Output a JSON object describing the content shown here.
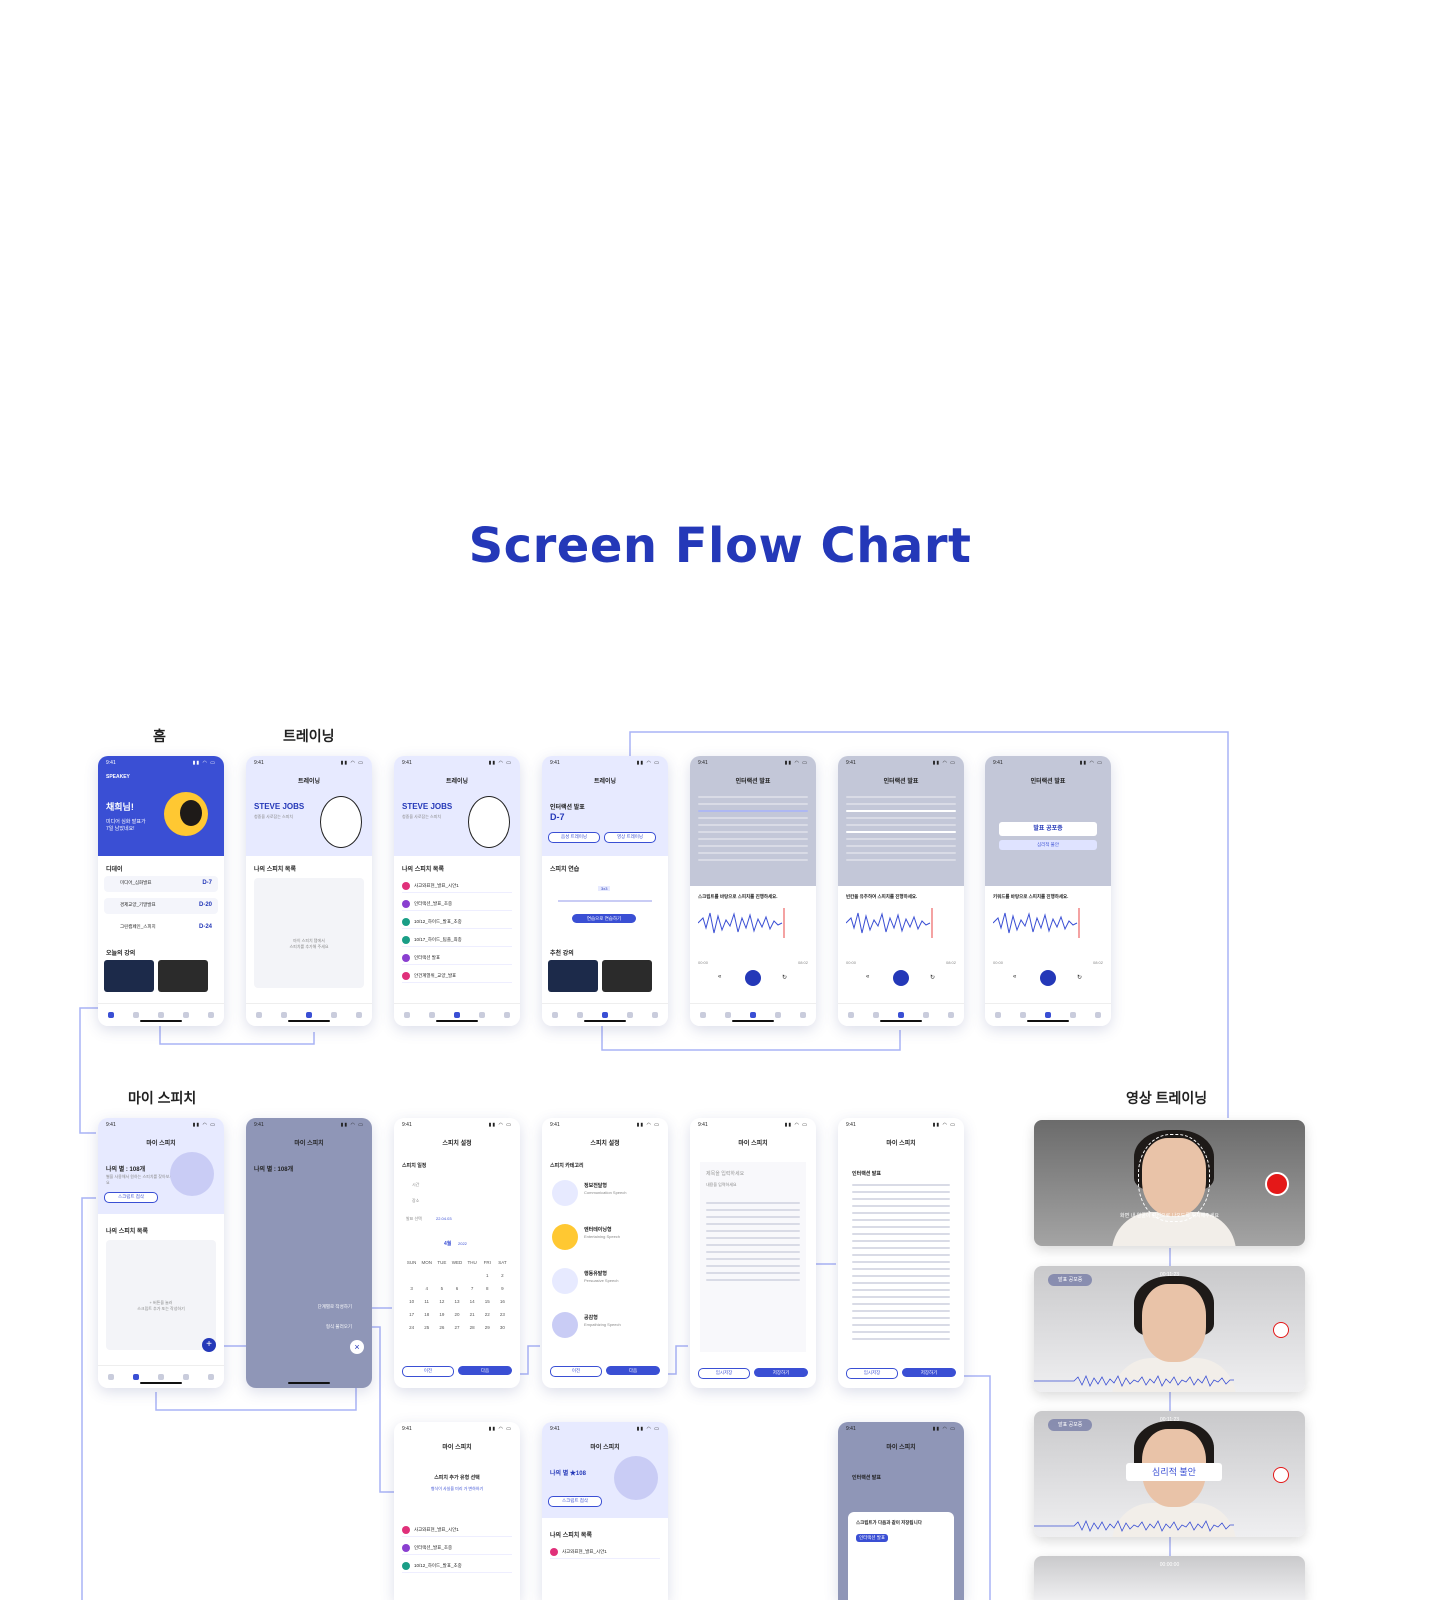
{
  "title": "Screen Flow Chart",
  "sections": {
    "home": "홈",
    "training": "트레이닝",
    "my_speech": "마이 스피치",
    "video_training": "영상 트레이닝"
  },
  "common": {
    "time": "9:41",
    "brand": "SPEAKEY"
  },
  "screens": {
    "home": {
      "greeting": "채희님!",
      "sub": "미디어 심화 발표가\n7일 남았네요!",
      "dday_label": "디데이",
      "items": [
        {
          "title": "미디어_심화발표",
          "badge": "D-7"
        },
        {
          "title": "경제교양_기말발표",
          "badge": "D-20"
        },
        {
          "title": "그린캠페인_스피치",
          "badge": "D-24"
        }
      ],
      "lecture_label": "오늘의 강의"
    },
    "training1": {
      "title": "트레이닝",
      "hero": "STEVE JOBS",
      "hero_sub": "청중을 사로잡는 스피치",
      "list_label": "나의 스피치 목록",
      "empty": "마이 스피치 탭에서\n스피치를 추가해 주세요"
    },
    "training2": {
      "title": "트레이닝",
      "hero": "STEVE JOBS",
      "hero_sub": "청중을 사로잡는 스피치",
      "list_label": "나의 스피치 목록",
      "items": [
        "사고와표현_발표_시안1",
        "인터랙션_발표_초중",
        "10/12_하이드_발표_초중",
        "10/17_하이드_팀플_최종",
        "인터랙션 발표",
        "안건계열위_교양_발표"
      ]
    },
    "training3": {
      "title": "트레이닝",
      "speech": "인터랙션 발표",
      "dday": "D-7",
      "btn1": "음성 트레이닝",
      "btn2": "영상 트레이닝",
      "practice_label": "스피치 연습",
      "value": "3x3",
      "cta": "연습으로 연습하기",
      "lecture_label": "추천 강의"
    },
    "script1": {
      "title": "인터랙션 발표",
      "guide": "스크립트를 바탕으로 스피치를 진행하세요.",
      "t_start": "00:00",
      "t_end": "08:02"
    },
    "script2": {
      "title": "인터랙션 발표",
      "guide": "빈칸을 유추하여 스피치를 진행하세요.",
      "t_start": "00:00",
      "t_end": "08:02"
    },
    "script3": {
      "title": "인터랙션 발표",
      "tag1": "발표 공포증",
      "tag2": "심리적 불안",
      "guide": "키워드를 바탕으로 스피치를 진행하세요.",
      "t_start": "00:00",
      "t_end": "08:02"
    },
    "my1": {
      "title": "마이 스피치",
      "star": "나의 별 : 108개",
      "hint": "별을 사용해서 원하는 스피치를 찾아보세요",
      "btn": "스크립트 첨삭",
      "list_label": "나의 스피치 목록",
      "empty": "+ 버튼을 눌러\n스크립트 추가 또는 작성하기"
    },
    "my2": {
      "title": "마이 스피치",
      "star": "나의 별 : 108개",
      "menu1": "단계별로 작성하기",
      "menu2": "형식 불러오기"
    },
    "setup1": {
      "title": "스피치 설정",
      "label": "스피치 일정",
      "f1": "시간",
      "f2": "장소",
      "f3": "발표 선택",
      "date": "22.04.03",
      "month": "4월",
      "year": "2022",
      "days": [
        "SUN",
        "MON",
        "TUE",
        "WED",
        "THU",
        "FRI",
        "SAT"
      ],
      "prev": "이전",
      "next": "다음"
    },
    "setup2": {
      "title": "스피치 설정",
      "label": "스피치 카테고리",
      "cats": [
        {
          "name": "정보전달형",
          "en": "Communication Speech"
        },
        {
          "name": "엔터테이닝형",
          "en": "Entertaining Speech"
        },
        {
          "name": "행동유발형",
          "en": "Persuasive Speech"
        },
        {
          "name": "공감형",
          "en": "Empathizing Speech"
        }
      ],
      "prev": "이전",
      "next": "다음"
    },
    "write": {
      "title": "마이 스피치",
      "placeholder": "제목을 입력하세요",
      "sub": "내용을 입력하세요",
      "btn1": "임시저장",
      "btn2": "저장하기"
    },
    "script_view": {
      "title": "마이 스피치",
      "speech": "인터랙션 발표",
      "btn1": "임시저장",
      "btn2": "저장하기"
    },
    "add": {
      "title": "마이 스피치",
      "heading": "스피치 추가 유형 선택",
      "desc": "형식이 사실을 미리 가 변하하기",
      "items": [
        "사고와표현_발표_시안1",
        "인터랙션_발표_초중",
        "10/12_하이드_발표_초중"
      ]
    },
    "my3": {
      "title": "마이 스피치",
      "star": "나의 별 ★108",
      "btn": "스크립트 첨삭",
      "list_label": "나의 스피치 목록",
      "item": "사고와표현_발표_시안1"
    },
    "modal": {
      "title": "마이 스피치",
      "speech": "인터랙션 발표",
      "heading": "스크립트가 다음과 같이 저장됩니다",
      "tag": "인터랙션 발표"
    }
  },
  "video": {
    "hint": "화면 내 얼굴이 점선으로 나오도록 위치해주세요",
    "badge": "발표 공포증",
    "time": "00:11:23",
    "keyword": "심리적 불안",
    "time4": "00:00:00"
  },
  "colors": {
    "accent": "#2438b8",
    "primary": "#3a4fd4",
    "light": "#e7eaff",
    "flow": "#a9b3f5"
  }
}
